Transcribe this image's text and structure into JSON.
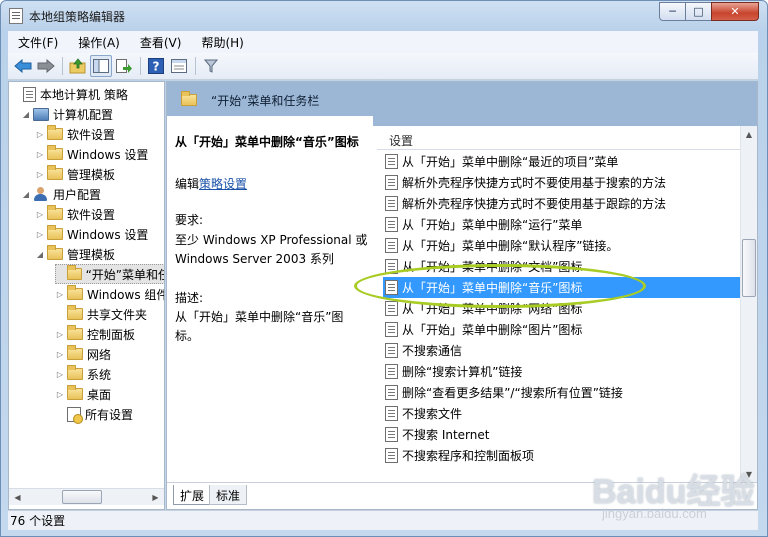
{
  "window": {
    "title": "本地组策略编辑器",
    "min_glyph": "─",
    "max_glyph": "□",
    "close_glyph": "✕"
  },
  "menu": [
    "文件(F)",
    "操作(A)",
    "查看(V)",
    "帮助(H)"
  ],
  "toolbar": {
    "icons": [
      "back-arrow-icon",
      "forward-arrow-icon",
      "up-folder-icon",
      "show-hide-tree-icon",
      "export-list-icon",
      "help-icon",
      "properties-view-icon",
      "filter-icon"
    ]
  },
  "tree": {
    "items": [
      {
        "label": "本地计算机 策略",
        "icon": "policy-icon",
        "expander": "",
        "indent": 0
      },
      {
        "label": "计算机配置",
        "icon": "computer-icon",
        "expander": "◢",
        "indent": 1
      },
      {
        "label": "软件设置",
        "icon": "folder-icon",
        "expander": "▷",
        "indent": 2
      },
      {
        "label": "Windows 设置",
        "icon": "folder-icon",
        "expander": "▷",
        "indent": 2
      },
      {
        "label": "管理模板",
        "icon": "folder-icon",
        "expander": "▷",
        "indent": 2
      },
      {
        "label": "用户配置",
        "icon": "user-icon",
        "expander": "◢",
        "indent": 1
      },
      {
        "label": "软件设置",
        "icon": "folder-icon",
        "expander": "▷",
        "indent": 2
      },
      {
        "label": "Windows 设置",
        "icon": "folder-icon",
        "expander": "▷",
        "indent": 2
      },
      {
        "label": "管理模板",
        "icon": "folder-icon",
        "expander": "◢",
        "indent": 2
      },
      {
        "label": "“开始”菜单和任务栏",
        "icon": "folder-icon",
        "expander": "",
        "indent": 3,
        "selected": true
      },
      {
        "label": "Windows 组件",
        "icon": "folder-icon",
        "expander": "▷",
        "indent": 3
      },
      {
        "label": "共享文件夹",
        "icon": "folder-icon",
        "expander": "",
        "indent": 3
      },
      {
        "label": "控制面板",
        "icon": "folder-icon",
        "expander": "▷",
        "indent": 3
      },
      {
        "label": "网络",
        "icon": "folder-icon",
        "expander": "▷",
        "indent": 3
      },
      {
        "label": "系统",
        "icon": "folder-icon",
        "expander": "▷",
        "indent": 3
      },
      {
        "label": "桌面",
        "icon": "folder-icon",
        "expander": "▷",
        "indent": 3
      },
      {
        "label": "所有设置",
        "icon": "all-settings-icon",
        "expander": "",
        "indent": 3
      }
    ]
  },
  "header": {
    "title": "“开始”菜单和任务栏"
  },
  "description": {
    "title": "从「开始」菜单中删除“音乐”图标",
    "edit_prefix": "编辑",
    "edit_link": "策略设置",
    "requirements_heading": "要求:",
    "requirements": "至少 Windows XP Professional 或 Windows Server 2003 系列",
    "description_heading": "描述:",
    "description_text": "从「开始」菜单中删除“音乐”图标。"
  },
  "list": {
    "column_header": "设置",
    "rows": [
      "从「开始」菜单中删除“最近的项目”菜单",
      "解析外壳程序快捷方式时不要使用基于搜索的方法",
      "解析外壳程序快捷方式时不要使用基于跟踪的方法",
      "从「开始」菜单中删除“运行”菜单",
      "从「开始」菜单中删除“默认程序”链接。",
      "从「开始」菜单中删除“文档”图标",
      "从「开始」菜单中删除“音乐”图标",
      "从「开始」菜单中删除“网络”图标",
      "从「开始」菜单中删除“图片”图标",
      "不搜索通信",
      "删除“搜索计算机”链接",
      "删除“查看更多结果”/“搜索所有位置”链接",
      "不搜索文件",
      "不搜索 Internet",
      "不搜索程序和控制面板项"
    ],
    "selected_index": 6
  },
  "tabs": [
    "扩展",
    "标准"
  ],
  "status": "76 个设置",
  "watermark": {
    "main": "Baidu经验",
    "sub": "jingyan.baidu.com"
  },
  "colors": {
    "selection": "#3399ff",
    "header_band": "#9cb7d6",
    "highlight_oval": "#a8cc24"
  }
}
